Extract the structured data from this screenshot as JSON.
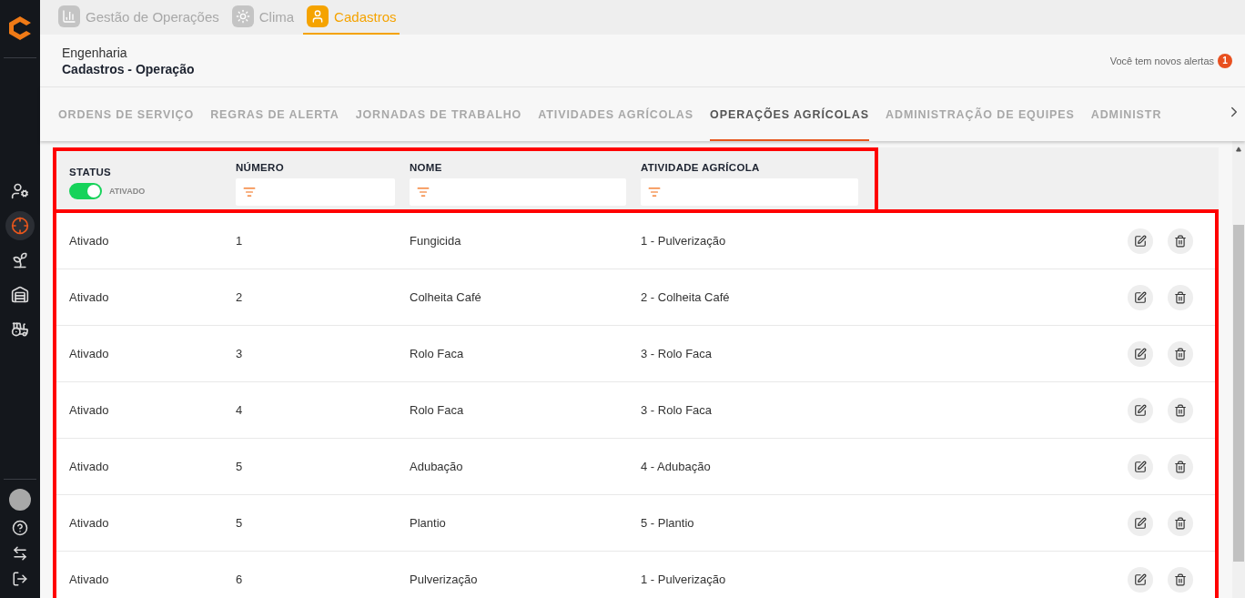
{
  "app_tabs": [
    {
      "label": "Gestão de Operações",
      "kind": "chart",
      "selected": false
    },
    {
      "label": "Clima",
      "kind": "sun",
      "selected": false
    },
    {
      "label": "Cadastros",
      "kind": "user",
      "selected": true
    }
  ],
  "header": {
    "section": "Engenharia",
    "title": "Cadastros - Operação",
    "alerts_text": "Você tem novos alertas",
    "alerts_count": "1"
  },
  "sidebar": {
    "items": [
      {
        "kind": "user-cog",
        "selected": false
      },
      {
        "kind": "target",
        "selected": true
      },
      {
        "kind": "sprout",
        "selected": false
      },
      {
        "kind": "silo",
        "selected": false
      },
      {
        "kind": "tractor",
        "selected": false
      }
    ],
    "bottom": [
      {
        "kind": "avatar"
      },
      {
        "kind": "help"
      },
      {
        "kind": "swap"
      },
      {
        "kind": "logout"
      }
    ]
  },
  "nav_tabs": [
    {
      "label": "ORDENS DE SERVIÇO",
      "selected": false
    },
    {
      "label": "REGRAS DE ALERTA",
      "selected": false
    },
    {
      "label": "JORNADAS DE TRABALHO",
      "selected": false
    },
    {
      "label": "ATIVIDADES AGRÍCOLAS",
      "selected": false
    },
    {
      "label": "OPERAÇÕES AGRÍCOLAS",
      "selected": true
    },
    {
      "label": "ADMINISTRAÇÃO DE EQUIPES",
      "selected": false
    },
    {
      "label": "ADMINISTR",
      "selected": false
    }
  ],
  "filters": {
    "highlighted": true,
    "status": {
      "label": "STATUS",
      "on": true,
      "toggle_label": "ATIVADO"
    },
    "columns": [
      {
        "label": "NÚMERO"
      },
      {
        "label": "NOME"
      },
      {
        "label": "ATIVIDADE AGRÍCOLA"
      }
    ]
  },
  "table": {
    "highlighted": true,
    "rows": [
      {
        "status": "Ativado",
        "number": "1",
        "name": "Fungicida",
        "activity": "1 - Pulverização"
      },
      {
        "status": "Ativado",
        "number": "2",
        "name": "Colheita Café",
        "activity": "2 - Colheita Café"
      },
      {
        "status": "Ativado",
        "number": "3",
        "name": "Rolo Faca",
        "activity": "3 - Rolo Faca"
      },
      {
        "status": "Ativado",
        "number": "4",
        "name": "Rolo Faca",
        "activity": "3 - Rolo Faca"
      },
      {
        "status": "Ativado",
        "number": "5",
        "name": "Adubação",
        "activity": "4 - Adubação"
      },
      {
        "status": "Ativado",
        "number": "5",
        "name": "Plantio",
        "activity": "5 - Plantio"
      },
      {
        "status": "Ativado",
        "number": "6",
        "name": "Pulverização",
        "activity": "1 - Pulverização"
      }
    ]
  }
}
